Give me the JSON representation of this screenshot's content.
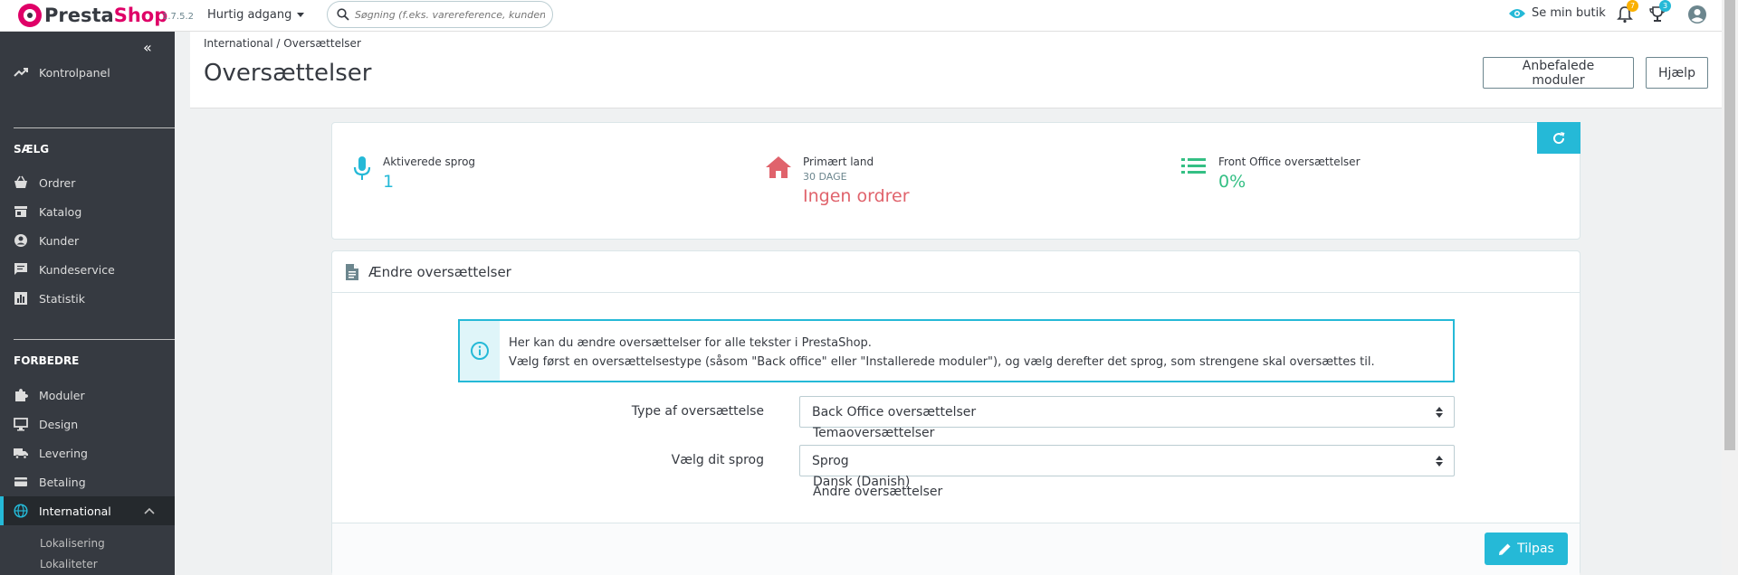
{
  "header": {
    "logo_main": "Presta",
    "logo_accent": "Shop",
    "version": "1.7.5.2",
    "quick_access": "Hurtig adgang",
    "search_placeholder": "Søgning (f.eks. varereference, kundenavn...)",
    "see_shop": "Se min butik",
    "notifications_count": "7",
    "trophy_count": "3"
  },
  "sidebar": {
    "dashboard": "Kontrolpanel",
    "sell_title": "SÆLG",
    "sell_items": [
      "Ordrer",
      "Katalog",
      "Kunder",
      "Kundeservice",
      "Statistik"
    ],
    "improve_title": "FORBEDRE",
    "improve_items": [
      "Moduler",
      "Design",
      "Levering",
      "Betaling",
      "International"
    ],
    "sub_items": [
      "Lokalisering",
      "Lokaliteter"
    ]
  },
  "toolbar": {
    "breadcrumb_parent": "International",
    "breadcrumb_current": "Oversættelser",
    "title": "Oversættelser",
    "recommended_modules": "Anbefalede moduler",
    "help": "Hjælp"
  },
  "kpi": {
    "languages_title": "Aktiverede sprog",
    "languages_value": "1",
    "country_title": "Primært land",
    "country_sub": "30 DAGE",
    "country_value": "Ingen ordrer",
    "front_title": "Front Office oversættelser",
    "front_value": "0%"
  },
  "panel": {
    "title": "Ændre oversættelser",
    "info_line1": "Her kan du ændre oversættelser for alle tekster i PrestaShop.",
    "info_line2": "Vælg først en oversættelsestype (såsom \"Back office\" eller \"Installerede moduler\"), og vælg derefter det sprog, som strengene skal oversættes til.",
    "type_label": "Type af oversættelse",
    "type_value": "Back Office oversættelser",
    "type_option_below": "Temaoversættelser",
    "lang_label": "Vælg dit sprog",
    "lang_value": "Sprog",
    "lang_option_1": "Dansk (Danish)",
    "lang_option_2": "Andre oversættelser",
    "save_button": "Tilpas"
  },
  "colors": {
    "accent": "#25b9d7",
    "danger": "#e0636c",
    "success": "#34bf84",
    "brand": "#df0067",
    "sidebar": "#363a41"
  }
}
